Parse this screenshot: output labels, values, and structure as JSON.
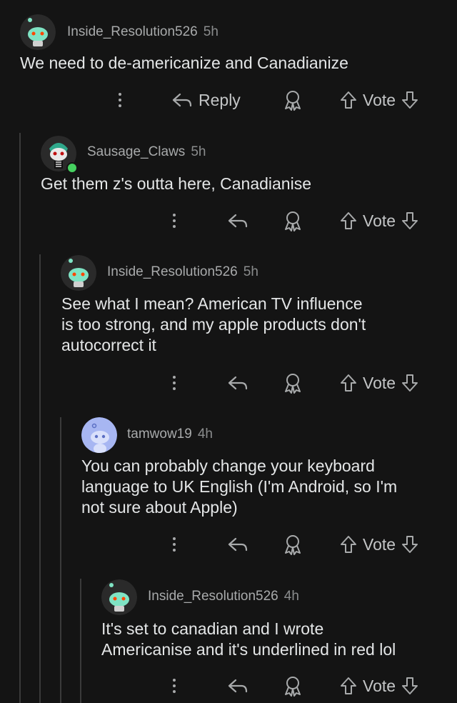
{
  "actions": {
    "reply_label": "Reply",
    "vote_label": "Vote"
  },
  "comments": [
    {
      "username": "Inside_Resolution526",
      "time": "5h",
      "text": "We need to de-americanize and Canadianize"
    },
    {
      "username": "Sausage_Claws",
      "time": "5h",
      "text": "Get them z's outta here, Canadianise"
    },
    {
      "username": "Inside_Resolution526",
      "time": "5h",
      "text": "See what I mean? American TV influence\nis too strong, and my apple products don't\nautocorrect it"
    },
    {
      "username": "tamwow19",
      "time": "4h",
      "text": "You can probably change your keyboard\nlanguage to UK English (I'm Android, so I'm\nnot sure about Apple)"
    },
    {
      "username": "Inside_Resolution526",
      "time": "4h",
      "text": "It's set to canadian and I wrote\nAmericanise and it's underlined in red lol"
    }
  ],
  "colors": {
    "background": "#141414",
    "thread_line": "#3a3a3a",
    "text": "#e4e6e7",
    "meta": "#a8aaab",
    "snoo_avatar_bg": "#2a2a2a",
    "tamwow_avatar_bg": "#a7b6f2",
    "online": "#46d160"
  }
}
